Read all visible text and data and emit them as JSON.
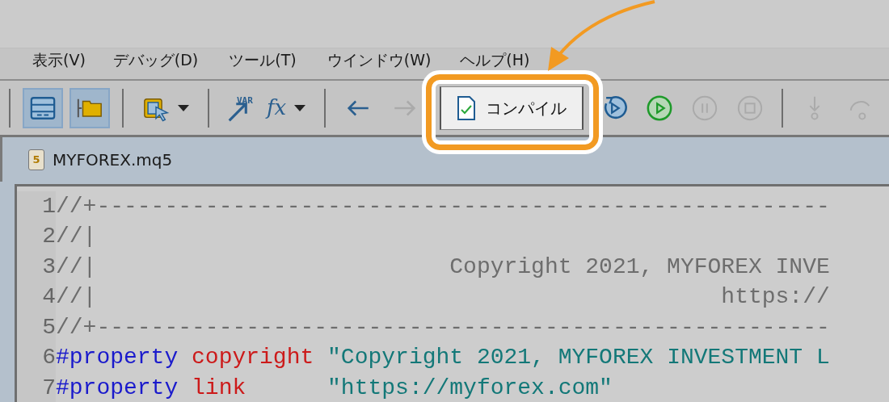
{
  "menu": [
    {
      "label": "表示(V)"
    },
    {
      "label": "デバッグ(D)"
    },
    {
      "label": "ツール(T)"
    },
    {
      "label": "ウインドウ(W)"
    },
    {
      "label": "ヘルプ(H)"
    }
  ],
  "toolbar": [
    {
      "kind": "separator"
    },
    {
      "kind": "toggle",
      "selected": true
    },
    {
      "kind": "toggle",
      "selected": true
    },
    {
      "kind": "separator"
    },
    {
      "kind": "tool",
      "disabled": false,
      "dropdown": true
    },
    {
      "kind": "separator"
    },
    {
      "kind": "tool",
      "disabled": false,
      "label": "VAR"
    },
    {
      "kind": "tool",
      "disabled": false,
      "label": "fx",
      "dropdown": true
    },
    {
      "kind": "separator"
    },
    {
      "kind": "tool",
      "disabled": false
    },
    {
      "kind": "tool",
      "disabled": true
    },
    {
      "kind": "button",
      "label": "コンパイル"
    },
    {
      "kind": "tool",
      "disabled": false
    },
    {
      "kind": "tool",
      "disabled": false
    },
    {
      "kind": "tool",
      "disabled": true
    },
    {
      "kind": "tool",
      "disabled": true
    },
    {
      "kind": "separator"
    },
    {
      "kind": "tool",
      "disabled": true
    },
    {
      "kind": "tool",
      "disabled": true
    }
  ],
  "tab": {
    "label": "MYFOREX.mq5",
    "badge": "5"
  },
  "code_lines": [
    {
      "number": "1",
      "segments": [
        {
          "kind": "comment",
          "text": "//+------------------------------------------------------"
        }
      ]
    },
    {
      "number": "2",
      "segments": [
        {
          "kind": "comment",
          "text": "//|"
        }
      ]
    },
    {
      "number": "3",
      "segments": [
        {
          "kind": "comment",
          "text": "//|                          Copyright 2021, MYFOREX INVE"
        }
      ]
    },
    {
      "number": "4",
      "segments": [
        {
          "kind": "comment",
          "text": "//|                                              https://"
        }
      ]
    },
    {
      "number": "5",
      "segments": [
        {
          "kind": "comment",
          "text": "//+------------------------------------------------------"
        }
      ]
    },
    {
      "number": "6",
      "segments": [
        {
          "kind": "keyword",
          "text": "#property "
        },
        {
          "kind": "name",
          "text": "copyright "
        },
        {
          "kind": "string",
          "text": "\"Copyright 2021, MYFOREX INVESTMENT L"
        }
      ]
    },
    {
      "number": "7",
      "segments": [
        {
          "kind": "keyword",
          "text": "#property "
        },
        {
          "kind": "name",
          "text": "link      "
        },
        {
          "kind": "string",
          "text": "\"https://myforex.com\""
        }
      ]
    }
  ]
}
